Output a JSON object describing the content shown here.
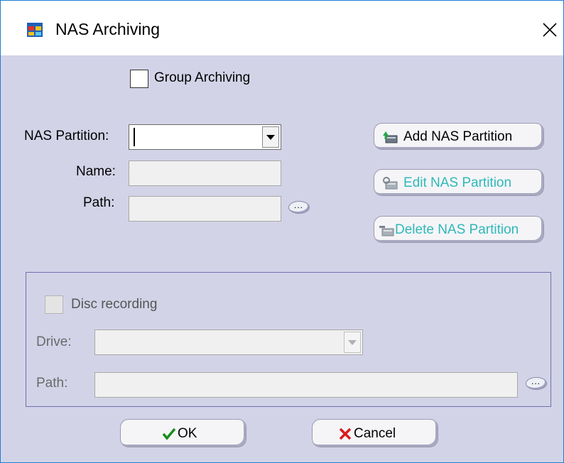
{
  "window": {
    "title": "NAS Archiving"
  },
  "group_archiving": {
    "label": "Group Archiving",
    "checked": false
  },
  "nas": {
    "partition_label": "NAS Partition:",
    "partition_value": "",
    "name_label": "Name:",
    "name_value": "",
    "path_label": "Path:",
    "path_value": "",
    "browse_label": "..."
  },
  "buttons": {
    "add": "Add NAS Partition",
    "edit": "Edit NAS Partition",
    "delete": "Delete NAS Partition",
    "ok": "OK",
    "cancel": "Cancel"
  },
  "disc": {
    "label": "Disc recording",
    "checked": false,
    "drive_label": "Drive:",
    "drive_value": "",
    "path_label": "Path:",
    "path_value": "",
    "browse_label": "..."
  },
  "colors": {
    "accent_text": "#30b8b8",
    "ok_check": "#1a8c1a",
    "cancel_x": "#d81c1c",
    "panel_bg": "#d3d3e8"
  },
  "icons": {
    "app": "app-window-icon",
    "close": "close-icon",
    "add": "add-partition-icon",
    "edit": "edit-partition-icon",
    "delete": "delete-partition-icon",
    "ok": "checkmark-icon",
    "cancel": "x-mark-icon"
  }
}
